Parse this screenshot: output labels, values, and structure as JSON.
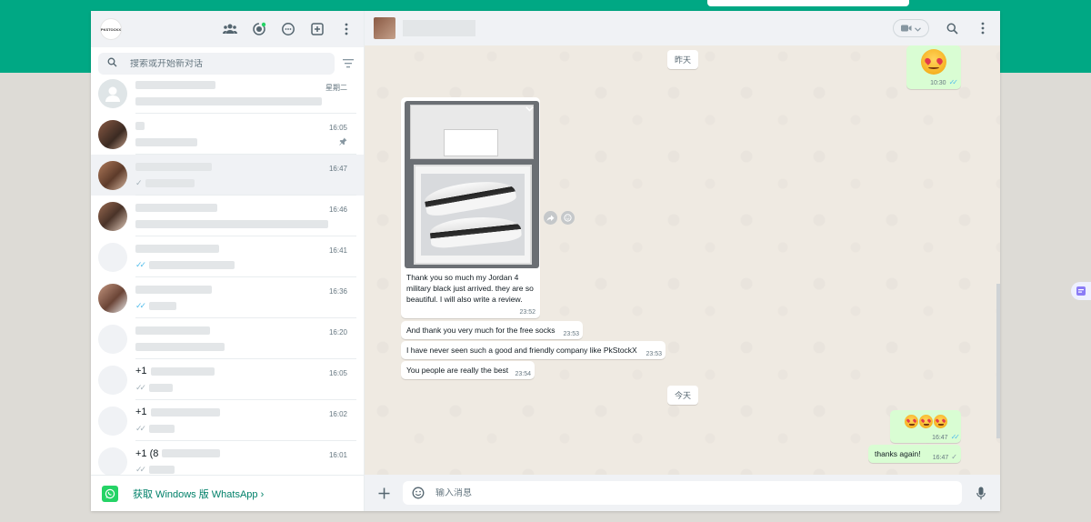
{
  "left": {
    "logo_text": "PKSTOCKX",
    "search_placeholder": "搜索或开始新对话",
    "chats": [
      {
        "name_prefix": "",
        "time": "星期二",
        "ticks": "",
        "avatar": "default",
        "pinned": false
      },
      {
        "name_prefix": "",
        "time": "16:05",
        "ticks": "",
        "avatar": "photo-a",
        "pinned": true
      },
      {
        "name_prefix": "",
        "time": "16:47",
        "ticks": "✓",
        "avatar": "photo-b",
        "pinned": false
      },
      {
        "name_prefix": "",
        "time": "16:46",
        "ticks": "",
        "avatar": "photo-c",
        "pinned": false
      },
      {
        "name_prefix": "",
        "time": "16:41",
        "ticks": "✓✓",
        "avatar": "blank",
        "pinned": false
      },
      {
        "name_prefix": "",
        "time": "16:36",
        "ticks": "✓✓",
        "avatar": "photo-d",
        "pinned": false
      },
      {
        "name_prefix": "",
        "time": "16:20",
        "ticks": "",
        "avatar": "blank",
        "pinned": false
      },
      {
        "name_prefix": "+1",
        "time": "16:05",
        "ticks": "✓✓",
        "avatar": "blank",
        "pinned": false
      },
      {
        "name_prefix": "+1",
        "time": "16:02",
        "ticks": "✓✓",
        "avatar": "blank",
        "pinned": false
      },
      {
        "name_prefix": "+1 (8",
        "time": "16:01",
        "ticks": "✓✓",
        "avatar": "blank",
        "pinned": false
      }
    ],
    "footer_text": "获取 Windows 版 WhatsApp ›"
  },
  "conversation": {
    "top_out_emoji_time": "10:30",
    "date_yesterday": "昨天",
    "image_caption": "Thank you so much my Jordan 4 military black just arrived. they are so beautiful. I will also write a review.",
    "image_time": "23:52",
    "incoming": [
      {
        "text": "And thank you very much for the free socks",
        "time": "23:53"
      },
      {
        "text": "I have never seen such a good and friendly company like PkStockX",
        "time": "23:53"
      },
      {
        "text": "You people are really the best",
        "time": "23:54"
      }
    ],
    "date_today": "今天",
    "out_emojis_time": "16:47",
    "out_text": "thanks again!",
    "out_text_time": "16:47"
  },
  "composer": {
    "placeholder": "输入消息"
  },
  "colors": {
    "brand_green": "#00a884",
    "outgoing_bubble": "#d9fdd3",
    "read_ticks": "#53bdeb"
  }
}
